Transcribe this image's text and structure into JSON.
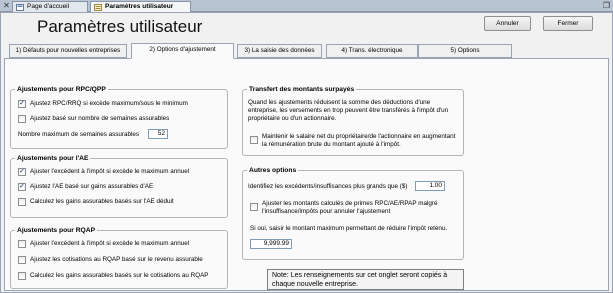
{
  "doc_tabs": [
    {
      "label": "Page d'accueil",
      "active": false
    },
    {
      "label": "Paramètres utilisateur",
      "active": true
    }
  ],
  "window": {
    "title": "Paramètres utilisateur",
    "cancel_label": "Annuler",
    "close_label": "Fermer"
  },
  "tabs": [
    {
      "label": "1) Défauts pour nouvelles entreprises",
      "active": false
    },
    {
      "label": "2) Options d'ajustement",
      "active": true
    },
    {
      "label": "3) La saisie des données",
      "active": false
    },
    {
      "label": "4) Trans. électronique",
      "active": false
    },
    {
      "label": "5) Options",
      "active": false
    }
  ],
  "rpc_group": {
    "title": "Ajustements pour RPC/QPP",
    "options": [
      {
        "label": "Ajustez RPC/RRQ si excède maximum/sous le minimum",
        "checked": true
      },
      {
        "label": "Ajustez basé sur nombre de semaines assurables",
        "checked": false
      }
    ],
    "weeks_label": "Nombre maximum de semaines assurables",
    "weeks_value": "52"
  },
  "ae_group": {
    "title": "Ajustements pour l'AE",
    "options": [
      {
        "label": "Ajuster l'excédent à l'impôt si excède le maximum annuel",
        "checked": true
      },
      {
        "label": "Ajustez l'AE basé sur gains assurables d'AE",
        "checked": true
      },
      {
        "label": "Calculez les gains assurables basés sur l'AE déduit",
        "checked": false
      }
    ]
  },
  "rqap_group": {
    "title": "Ajustements pour RQAP",
    "options": [
      {
        "label": "Ajuster l'excédent à l'impôt si excède le maximum annuel",
        "checked": false
      },
      {
        "label": "Ajustez les cotisations au RQAP basé sur le revenu assurable",
        "checked": false
      },
      {
        "label": "Calculez les gains assurables basés sur le cotisations au RQAP",
        "checked": false
      }
    ]
  },
  "transfer_group": {
    "title": "Transfert des montants surpayés",
    "description": "Quand les ajustements réduisent la somme des déductions d'une entreprise, les versements en trop peuvent être transférés à l'impôt d'un propriétaire ou d'un actionnaire.",
    "option": {
      "label": "Maintenir le salaire net du propriétaire/de l'actionnaire en augmentant la rémunération brute du montant ajouté à l'impôt.",
      "checked": false
    }
  },
  "other_group": {
    "title": "Autres options",
    "threshold_label": "Identifiez les excédents/insuffisances plus grands que ($)",
    "threshold_value": "1.00",
    "option": {
      "label": "Ajuster les montants calculés de primes RPC/AE/RPAP malgré l'insuffisance/impôts pour annuler l'ajustement",
      "checked": false
    },
    "max_label": "Si oui, saisir le montant maximum permettant de réduire l'impôt retenu.",
    "max_value": "9,999.99"
  },
  "note": "Note: Les renseignements sur cet onglet seront copiés à chaque nouvelle entreprise."
}
